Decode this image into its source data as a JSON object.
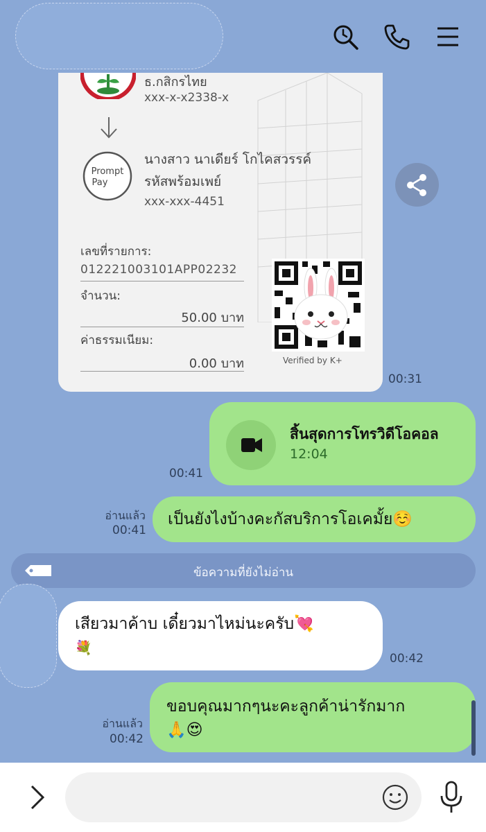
{
  "header": {
    "search_icon": "search-icon",
    "phone_icon": "phone-icon",
    "menu_icon": "menu-icon"
  },
  "receipt": {
    "bank_name": "ธ.กสิกรไทย",
    "from_account": "xxx-x-x2338-x",
    "recipient_name": "นางสาว นาเดียร์ โกไคสวรรค์",
    "promptpay_label": "รหัสพร้อมเพย์",
    "promptpay_number": "xxx-xxx-4451",
    "promptpay_logo": "Prompt Pay",
    "reference_label": "เลขที่รายการ:",
    "reference": "012221003101APP02232",
    "amount_label": "จำนวน:",
    "amount": "50.00 บาท",
    "fee_label": "ค่าธรรมเนียม:",
    "fee": "0.00 บาท",
    "verified": "Verified by K+",
    "time": "00:31"
  },
  "messages": [
    {
      "type": "call",
      "title": "สิ้นสุดการโทรวิดีโอคอล",
      "duration": "12:04",
      "time": "00:41"
    },
    {
      "type": "sent",
      "text": "เป็นยังไงบ้างคะกัสบริการโอเคมั้ย☺️",
      "read": "อ่านแล้ว",
      "time": "00:41"
    },
    {
      "type": "received",
      "text": "เสียวมาค้าบ เดี๋ยวมาไหม่นะครับ💘",
      "emoji_line": "💐",
      "time": "00:42"
    },
    {
      "type": "sent",
      "text": "ขอบคุณมากๆนะคะลูกค้าน่ารักมาก",
      "emoji_line": "🙏😍",
      "read": "อ่านแล้ว",
      "time": "00:42"
    }
  ],
  "unread_divider": "ข้อความที่ยังไม่อ่าน",
  "input_bar": {
    "placeholder": "",
    "expand_icon": "chevron-right-icon",
    "emoji_icon": "smiley-icon",
    "mic_icon": "microphone-icon"
  },
  "colors": {
    "background": "#8aa8d6",
    "sent_bubble": "#a2e48b",
    "received_bubble": "#ffffff"
  }
}
